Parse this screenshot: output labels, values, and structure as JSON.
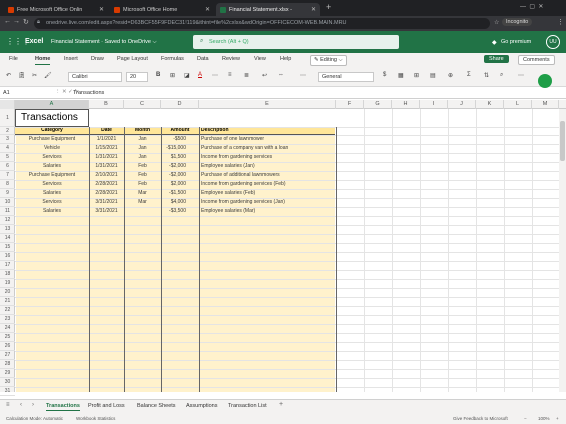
{
  "browser": {
    "tabs": [
      {
        "label": "Free Microsoft Office Onlin",
        "icon": "office-icon",
        "color": "#d83b01"
      },
      {
        "label": "Microsoft Office Home",
        "icon": "office-icon",
        "color": "#d83b01"
      },
      {
        "label": "Financial Statement.xlsx -",
        "icon": "excel-icon",
        "color": "#217346"
      }
    ],
    "url": "onedrive.live.com/edit.aspx?resid=D63BCF55F9FDEC31!119&ithint=file%2cxlsx&wdOrigin=OFFICECOM-WEB.MAIN.MRU",
    "profile": "Incognito"
  },
  "app": {
    "name": "Excel",
    "doc_title": "Financial Statement · Saved to OneDrive ⌵",
    "search_placeholder": "Search (Alt + Q)",
    "premium": "Go premium",
    "avatar": "UU",
    "accent": "#217346"
  },
  "ribbon": {
    "tabs": [
      "File",
      "Home",
      "Insert",
      "Draw",
      "Page Layout",
      "Formulas",
      "Data",
      "Review",
      "View",
      "Help"
    ],
    "editing": "✎ Editing ⌵",
    "share": "Share",
    "comments": "Comments",
    "font": "Calibri",
    "size": "20",
    "format": "General"
  },
  "formula_bar": {
    "cell_ref": "A1",
    "content": "Transactions"
  },
  "columns": [
    "A",
    "B",
    "C",
    "D",
    "E",
    "F",
    "G",
    "H",
    "I",
    "J",
    "K",
    "L",
    "M"
  ],
  "rows": [
    "1",
    "2",
    "3",
    "4",
    "5",
    "6",
    "7",
    "8",
    "9",
    "10",
    "11",
    "12",
    "13",
    "14",
    "15",
    "16",
    "17",
    "18",
    "19",
    "20",
    "21",
    "22",
    "23",
    "24",
    "25",
    "26",
    "27",
    "28",
    "29",
    "30",
    "31"
  ],
  "sheet": {
    "title": "Transactions",
    "headers": [
      "Category",
      "Date",
      "Month",
      "Amount",
      "Description"
    ],
    "data": [
      [
        "Purchase Equipment",
        "1/1/2021",
        "Jan",
        "-$500",
        "Purchase of one lawnmower"
      ],
      [
        "Vehicle",
        "1/15/2021",
        "Jan",
        "-$15,000",
        "Purchase of a company van with a loan"
      ],
      [
        "Services",
        "1/31/2021",
        "Jan",
        "$1,500",
        "Income from gardening services"
      ],
      [
        "Salaries",
        "1/31/2021",
        "Feb",
        "-$2,000",
        "Employee salaries (Jan)"
      ],
      [
        "Purchase Equipment",
        "2/10/2021",
        "Feb",
        "-$2,000",
        "Purchase of additional lawnmowers"
      ],
      [
        "Services",
        "2/28/2021",
        "Feb",
        "$2,000",
        "Income from gardening services (Feb)"
      ],
      [
        "Salaries",
        "2/28/2021",
        "Mar",
        "-$1,500",
        "Employee salaries (Feb)"
      ],
      [
        "Services",
        "3/31/2021",
        "Mar",
        "$4,000",
        "Income from gardening services (Jan)"
      ],
      [
        "Salaries",
        "3/31/2021",
        "",
        "-$3,500",
        "Employee salaries (Mar)"
      ]
    ]
  },
  "sheet_tabs": [
    "Transactions",
    "Profit and Loss",
    "Balance Sheets",
    "Assumptions",
    "Transaction List"
  ],
  "status": {
    "calc": "Calculation Mode: Automatic",
    "stats": "Workbook Statistics",
    "feedback": "Give Feedback to Microsoft",
    "zoom": "100%"
  }
}
